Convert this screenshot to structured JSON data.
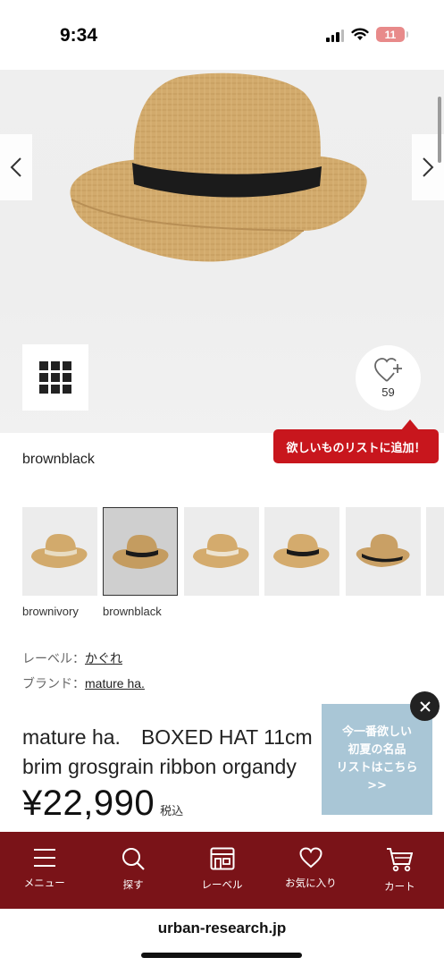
{
  "status_bar": {
    "time": "9:34",
    "battery_level": "11"
  },
  "product": {
    "favorite_count": "59",
    "wishlist_prompt": "欲しいものリストに追加！",
    "selected_color": "brownblack",
    "color_options": [
      {
        "label": "brownivory",
        "band_color": "#e8dcc2"
      },
      {
        "label": "brownblack",
        "band_color": "#1a1a1a"
      },
      {
        "label": "",
        "band_color": "#ede3d0"
      },
      {
        "label": "",
        "band_color": "#1a1a1a"
      },
      {
        "label": "",
        "band_color": "#1a1a1a"
      }
    ],
    "label_key": "レーベル：",
    "label_value": "かぐれ",
    "brand_key": "ブランド：",
    "brand_value": "mature ha.",
    "title": "mature ha.　BOXED HAT 11cm brim grosgrain ribbon organdy",
    "price": "¥22,990",
    "tax_note": "税込"
  },
  "popup": {
    "line1": "今一番欲しい",
    "line2": "初夏の名品",
    "line3": "リストはこちら",
    "line4": ">>"
  },
  "bottom_nav": [
    {
      "label": "メニュー",
      "icon": "menu-icon"
    },
    {
      "label": "探す",
      "icon": "search-icon"
    },
    {
      "label": "レーベル",
      "icon": "store-icon"
    },
    {
      "label": "お気に入り",
      "icon": "heart-icon"
    },
    {
      "label": "カート",
      "icon": "cart-icon"
    }
  ],
  "browser": {
    "url": "urban-research.jp"
  },
  "colors": {
    "brand_red": "#c8161d",
    "nav_bg": "#7a1318",
    "popup_bg": "#a9c6d6"
  }
}
